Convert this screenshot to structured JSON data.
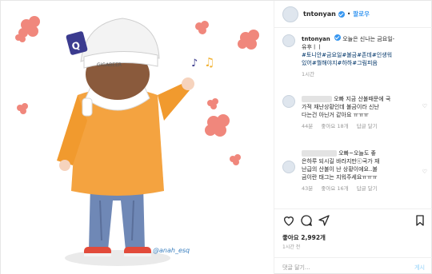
{
  "header": {
    "username": "tntonyan",
    "separator": "•",
    "follow_label": "팔로우"
  },
  "caption": {
    "username": "tntonyan",
    "text_1": "오늘은 신나는 금요일-",
    "text_2": "유후ㅣㅣ",
    "tags_1": "#토니안#금요일#불금#존데#인생워",
    "tags_2": "있어#뭘해야지#하하#그림피음",
    "time": "1시간"
  },
  "comment1": {
    "line_1": "오빠 지금 산불때문에 국",
    "line_2": "가적 재난상황인데 불금이라 신난",
    "line_3": "다는건 아닌거 같아요 ㅠㅠㅠ",
    "time": "44분",
    "likes": "좋아요 18개",
    "reply": "답글 달기"
  },
  "comment2": {
    "line_1": "오빠~오늘도 좋",
    "line_2": "은하루 되시길 바라지만ⓒ국가 재",
    "line_3": "난급의 산불이 난 상황이에요..불",
    "line_4": "금이란 태그는 지워주세요ㅠㅠㅠ",
    "time": "43분",
    "likes": "좋아요 16개",
    "reply": "답글 달기"
  },
  "actions": {
    "likes": "좋아요 2,992개",
    "time": "1시간 전",
    "comment_placeholder": "댓글 달기...",
    "post_label": "게시"
  },
  "image": {
    "cap_text": "GIGABEER",
    "signature": "@anah_esq",
    "flower_color": "#f0877c",
    "jacket_color": "#f4a340"
  }
}
